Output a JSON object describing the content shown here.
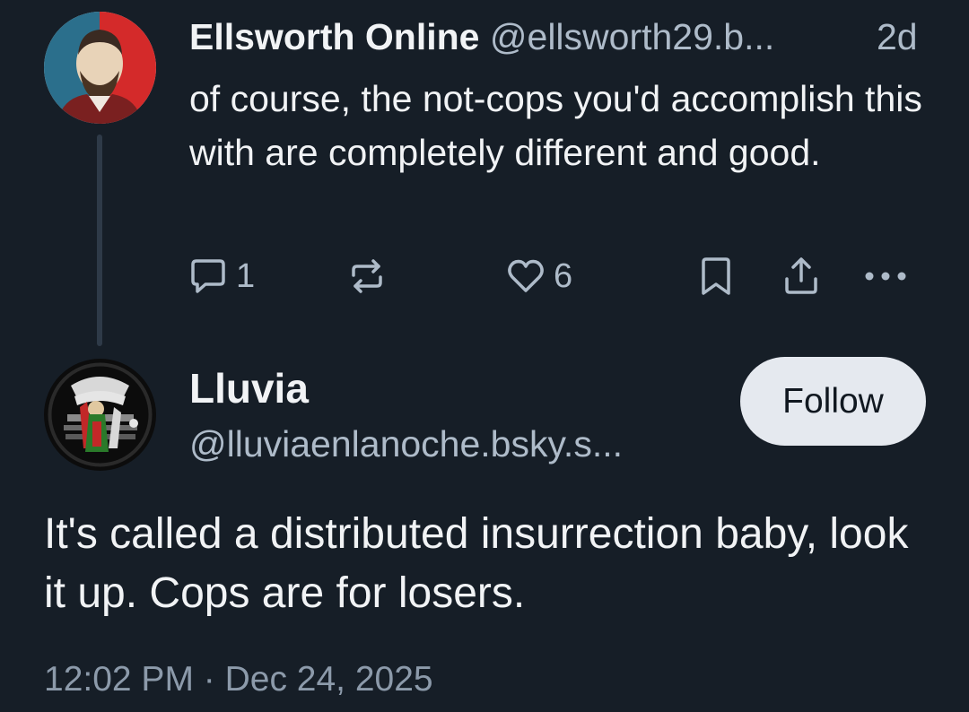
{
  "parent_post": {
    "author_name": "Ellsworth Online",
    "author_handle": "@ellsworth29.b...",
    "time_ago": "2d",
    "text": "of course, the not-cops you'd accomplish this with are completely different and good.",
    "actions": {
      "reply_count": "1",
      "like_count": "6"
    }
  },
  "main_post": {
    "author_name": "Lluvia",
    "author_handle": "@lluviaenlanoche.bsky.s...",
    "follow_label": "Follow",
    "text": "It's called a distributed insurrection baby, look it up. Cops are for losers.",
    "timestamp": "12:02 PM · Dec 24, 2025"
  },
  "icons": {
    "reply": "reply-icon",
    "repost": "repost-icon",
    "like": "heart-icon",
    "bookmark": "bookmark-icon",
    "share": "share-icon",
    "more": "more-icon"
  },
  "colors": {
    "background": "#161e27",
    "text_primary": "#f1f3f5",
    "text_secondary": "#aebbc9",
    "follow_button_bg": "#e5e9ef"
  }
}
